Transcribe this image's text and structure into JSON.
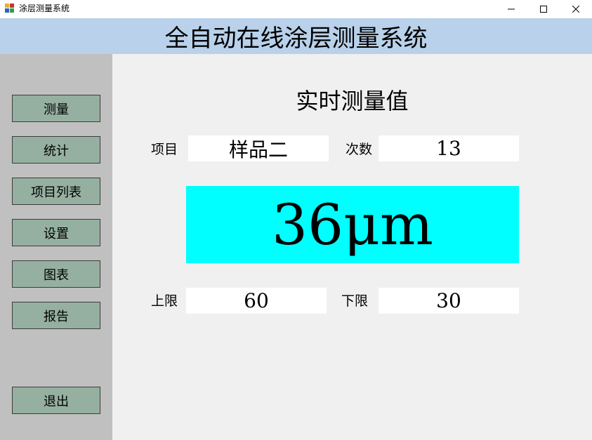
{
  "window": {
    "title": "涂层测量系统",
    "controls": {
      "minimize": "minimize-icon",
      "maximize": "maximize-icon",
      "close": "close-icon"
    }
  },
  "header": {
    "title": "全自动在线涂层测量系统"
  },
  "sidebar": {
    "items": [
      {
        "label": "测量"
      },
      {
        "label": "统计"
      },
      {
        "label": "项目列表"
      },
      {
        "label": "设置"
      },
      {
        "label": "图表"
      },
      {
        "label": "报告"
      }
    ],
    "exit_label": "退出"
  },
  "main": {
    "heading": "实时测量值",
    "item_label": "项目",
    "item_value": "样品二",
    "count_label": "次数",
    "count_value": "13",
    "reading": "36μm",
    "upper_label": "上限",
    "upper_value": "60",
    "lower_label": "下限",
    "lower_value": "30"
  },
  "colors": {
    "header_bg": "#b9d1ea",
    "sidebar_bg": "#c0c0c0",
    "button_bg": "#95b0a0",
    "reading_bg": "#00ffff",
    "main_bg": "#f0f0f0",
    "field_bg": "#ffffff"
  }
}
